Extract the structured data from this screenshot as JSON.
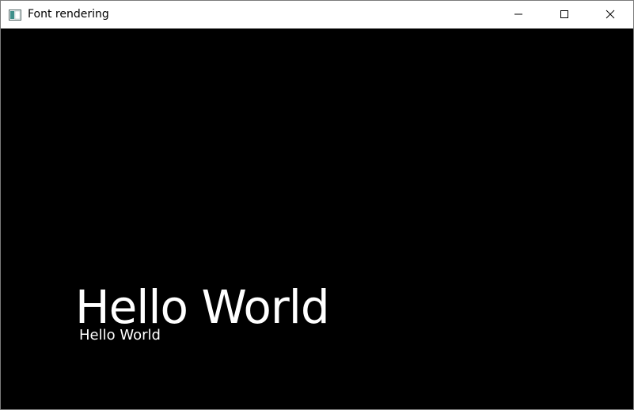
{
  "window": {
    "title": "Font rendering",
    "app_icon": "window-app-icon",
    "controls": {
      "minimize_icon": "minimize-icon",
      "maximize_icon": "maximize-icon",
      "close_icon": "close-icon"
    }
  },
  "canvas": {
    "background": "#000000",
    "text_color": "#ffffff",
    "large_text": "Hello World",
    "small_text": "Hello World"
  }
}
